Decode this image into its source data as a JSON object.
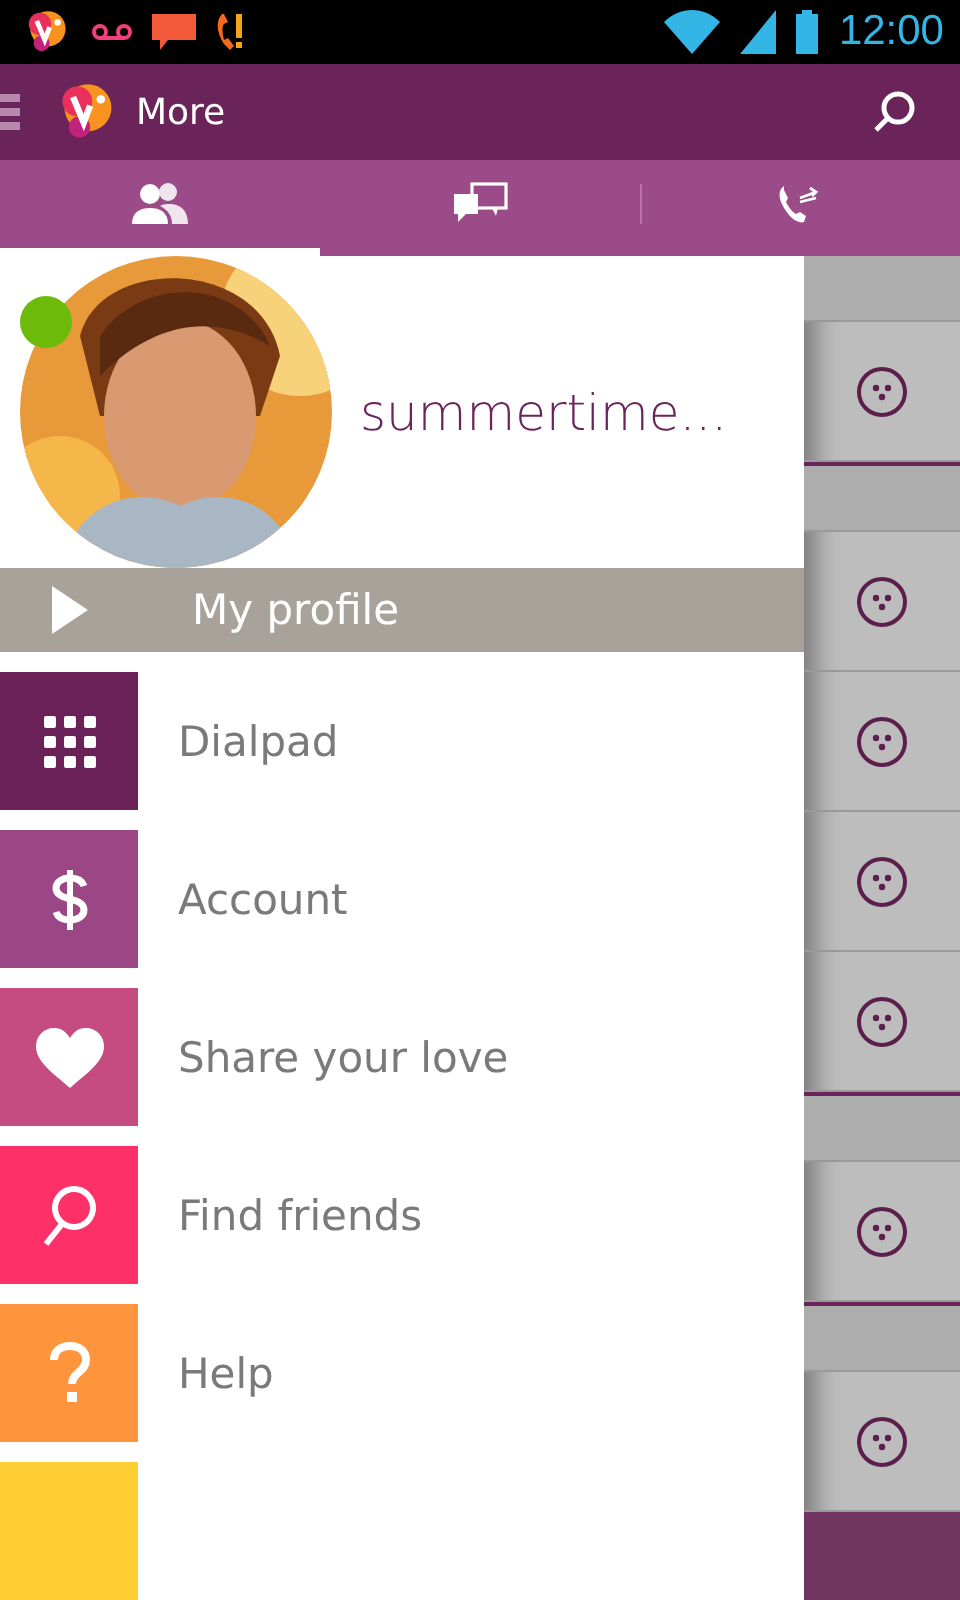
{
  "status_bar": {
    "time": "12:00"
  },
  "action_bar": {
    "title": "More"
  },
  "tabs": [
    {
      "kind": "contacts",
      "selected": true
    },
    {
      "kind": "chats",
      "selected": false
    },
    {
      "kind": "calls",
      "selected": false
    }
  ],
  "profile": {
    "name": "summertime...",
    "online": true
  },
  "profile_link": {
    "label": "My profile"
  },
  "menu": [
    {
      "kind": "dialpad",
      "label": "Dialpad",
      "color": "#6a2158"
    },
    {
      "kind": "dollar",
      "label": "Account",
      "color": "#9b4785"
    },
    {
      "kind": "heart",
      "label": "Share your love",
      "color": "#c44c80"
    },
    {
      "kind": "search",
      "label": "Find friends",
      "color": "#fe3068"
    },
    {
      "kind": "question",
      "label": "Help",
      "color": "#fe943b"
    },
    {
      "kind": "blank",
      "color": "#fece33"
    }
  ],
  "background_list": [
    {
      "kind": "section"
    },
    {
      "kind": "contact"
    },
    {
      "kind": "section"
    },
    {
      "kind": "contact"
    },
    {
      "kind": "contact"
    },
    {
      "kind": "contact"
    },
    {
      "kind": "contact"
    },
    {
      "kind": "section"
    },
    {
      "kind": "contact"
    },
    {
      "kind": "section"
    },
    {
      "kind": "contact"
    },
    {
      "kind": "bar"
    }
  ]
}
